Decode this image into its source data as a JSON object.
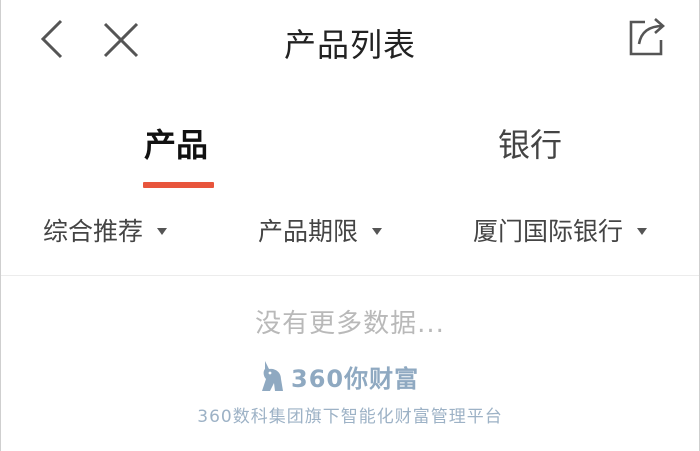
{
  "header": {
    "title": "产品列表",
    "back_icon": "chevron-left-icon",
    "close_icon": "close-icon",
    "share_icon": "share-icon"
  },
  "tabs": [
    {
      "label": "产品",
      "active": true
    },
    {
      "label": "银行",
      "active": false
    }
  ],
  "colors": {
    "accent": "#e8553c",
    "brand": "#8fa9c1"
  },
  "filters": [
    {
      "label": "综合推荐"
    },
    {
      "label": "产品期限"
    },
    {
      "label": "厦门国际银行"
    }
  ],
  "empty_state": {
    "text": "没有更多数据..."
  },
  "footer": {
    "brand_name": "360你财富",
    "brand_tagline": "360数科集团旗下智能化财富管理平台",
    "logo_icon": "unicorn-logo-icon"
  }
}
